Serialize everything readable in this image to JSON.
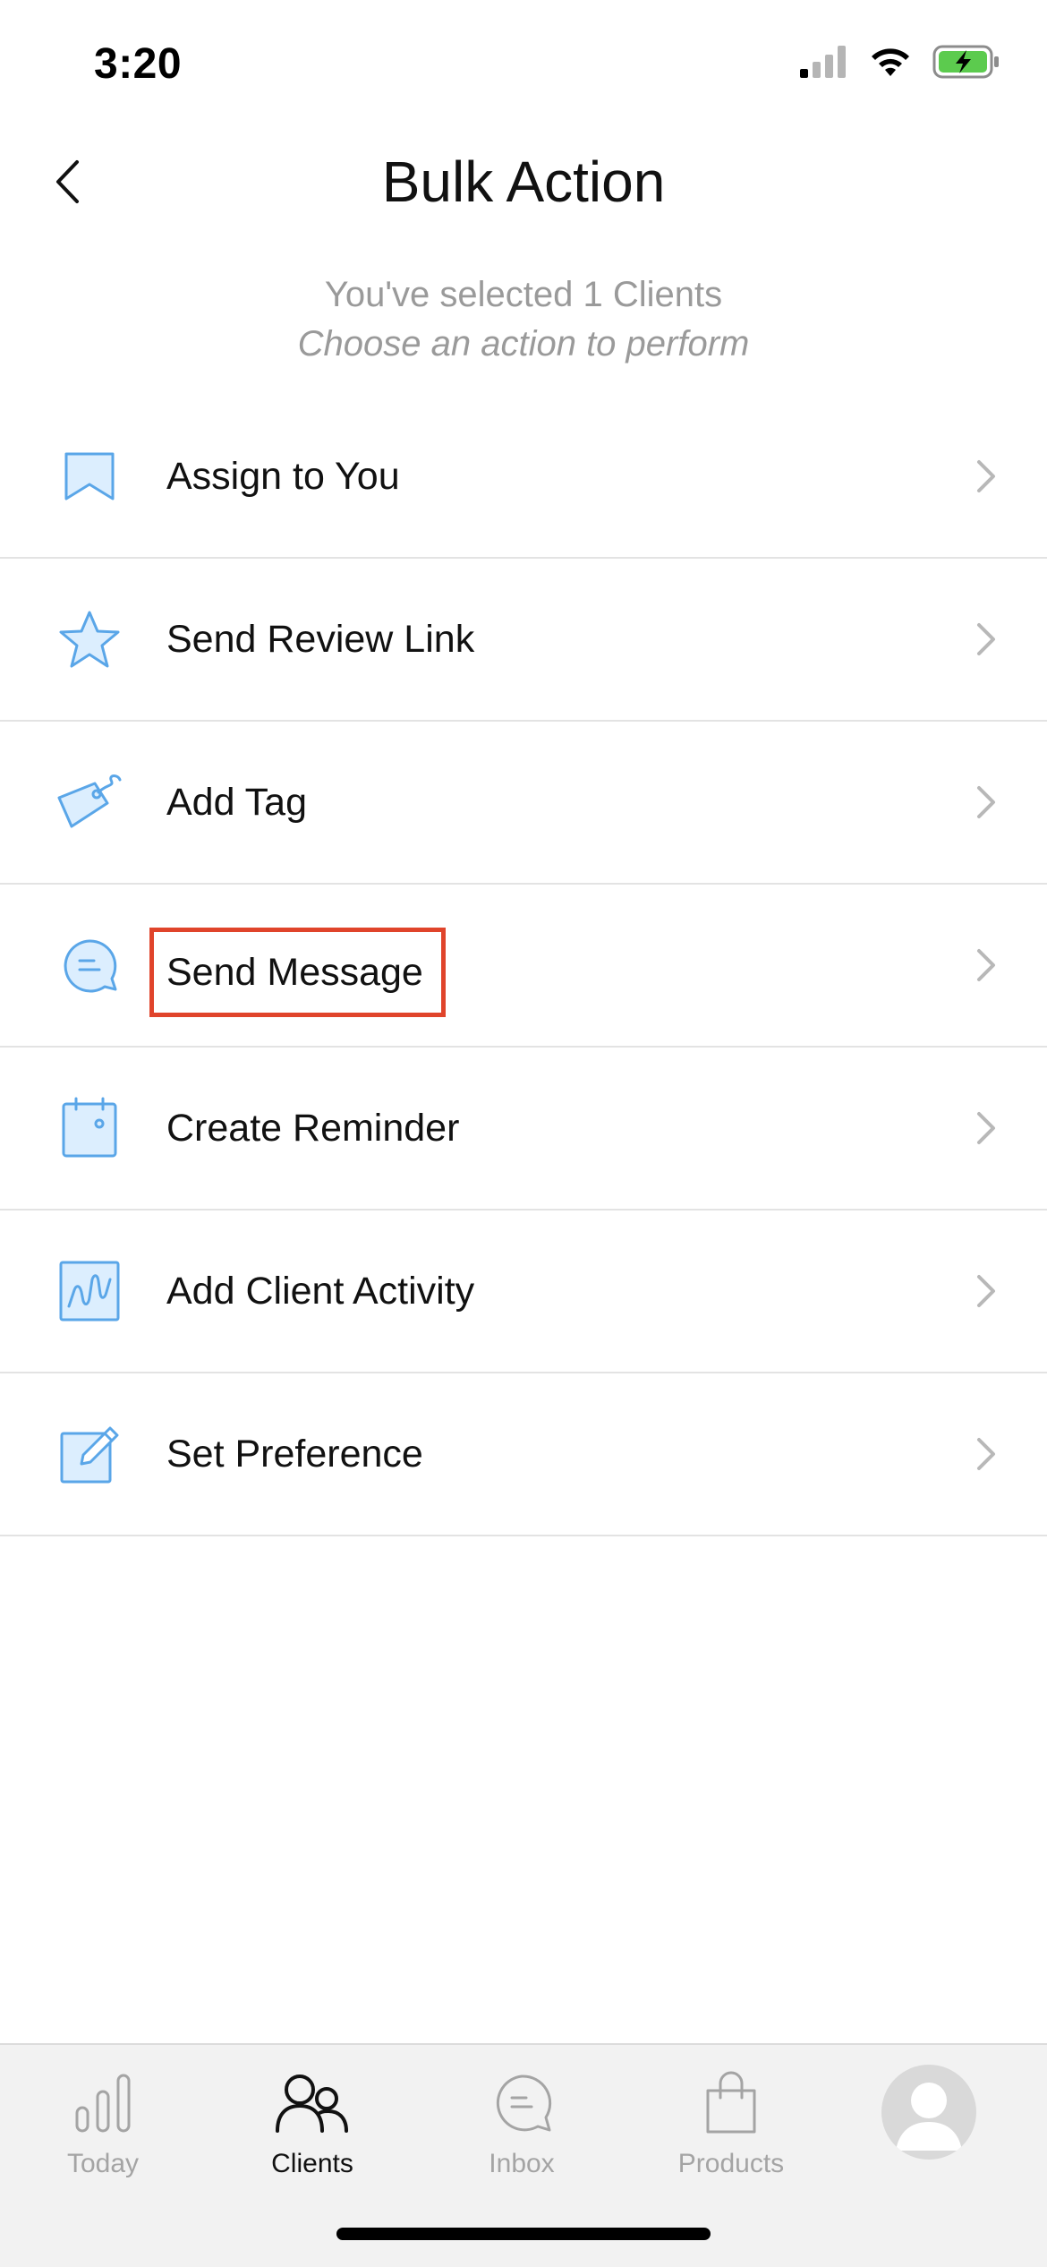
{
  "status_bar": {
    "time": "3:20"
  },
  "header": {
    "title": "Bulk Action"
  },
  "subtitle": {
    "line1": "You've selected 1 Clients",
    "line2": "Choose an action to perform"
  },
  "actions": [
    {
      "label": "Assign to You",
      "icon": "bookmark-icon"
    },
    {
      "label": "Send Review Link",
      "icon": "star-icon"
    },
    {
      "label": "Add Tag",
      "icon": "tag-icon"
    },
    {
      "label": "Send Message",
      "icon": "message-bubble-icon",
      "highlighted": true
    },
    {
      "label": "Create Reminder",
      "icon": "calendar-icon"
    },
    {
      "label": "Add Client Activity",
      "icon": "activity-icon"
    },
    {
      "label": "Set Preference",
      "icon": "edit-icon"
    }
  ],
  "bottom_nav": {
    "items": [
      {
        "label": "Today",
        "icon": "bar-chart-icon"
      },
      {
        "label": "Clients",
        "icon": "clients-icon",
        "active": true
      },
      {
        "label": "Inbox",
        "icon": "inbox-icon"
      },
      {
        "label": "Products",
        "icon": "shopping-bag-icon"
      }
    ],
    "profile_icon": "profile-avatar-icon"
  },
  "colors": {
    "accent_blue": "#5aa6e8",
    "icon_fill": "#dceefe",
    "highlight": "#e0442b",
    "battery_green": "#5ccb4e",
    "inactive_gray": "#a4a4a4"
  }
}
